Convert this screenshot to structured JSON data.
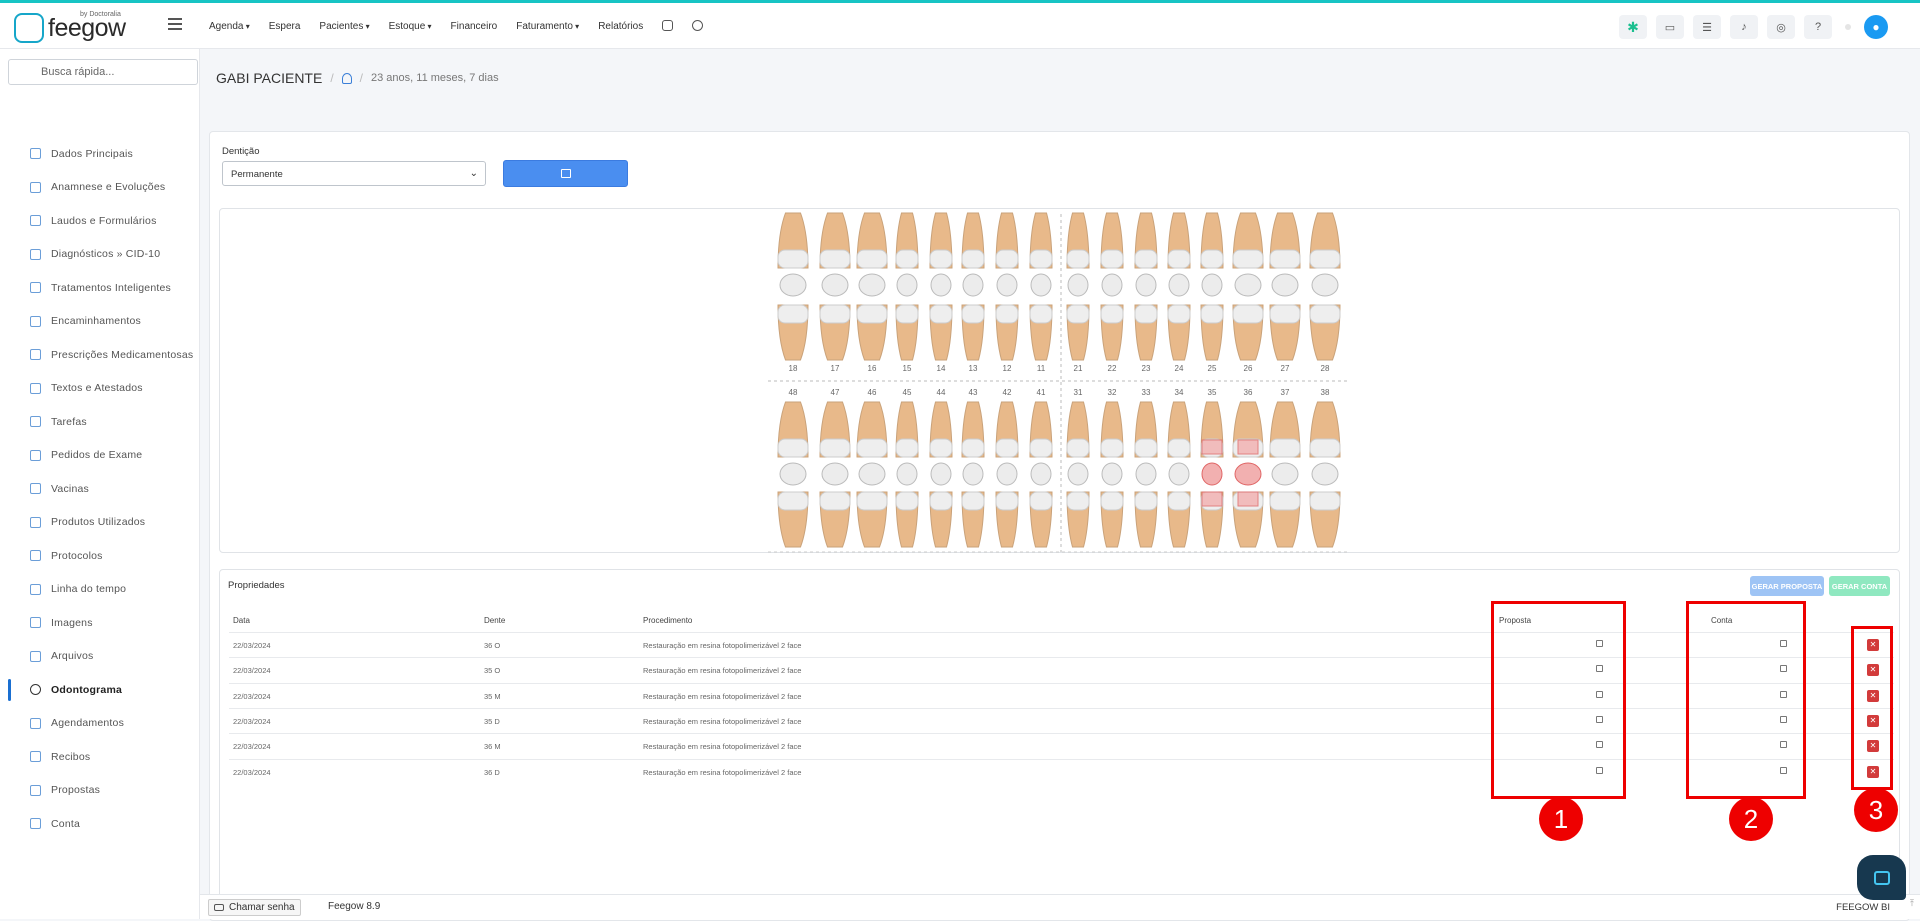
{
  "brand": {
    "name": "feegow",
    "sub": "by Doctoralia"
  },
  "nav": {
    "agenda": "Agenda",
    "espera": "Espera",
    "pacientes": "Pacientes",
    "estoque": "Estoque",
    "financeiro": "Financeiro",
    "faturamento": "Faturamento",
    "relatorios": "Relatórios"
  },
  "accent_color": "#17c4c4",
  "search": {
    "placeholder": "Busca rápida..."
  },
  "sidebar": {
    "items": [
      {
        "label": "Dados Principais",
        "icon": "user-icon"
      },
      {
        "label": "Anamnese e Evoluções",
        "icon": "chart-line-icon"
      },
      {
        "label": "Laudos e Formulários",
        "icon": "clipboard-icon"
      },
      {
        "label": "Diagnósticos » CID-10",
        "icon": "stethoscope-icon"
      },
      {
        "label": "Tratamentos Inteligentes",
        "icon": "stethoscope-icon"
      },
      {
        "label": "Encaminhamentos",
        "icon": "file-icon"
      },
      {
        "label": "Prescrições Medicamentosas",
        "icon": "pills-icon"
      },
      {
        "label": "Textos e Atestados",
        "icon": "file-text-icon"
      },
      {
        "label": "Tarefas",
        "icon": "list-icon"
      },
      {
        "label": "Pedidos de Exame",
        "icon": "clipboard-icon"
      },
      {
        "label": "Vacinas",
        "icon": "syringe-icon"
      },
      {
        "label": "Produtos Utilizados",
        "icon": "box-icon"
      },
      {
        "label": "Protocolos",
        "icon": "clipboard-icon"
      },
      {
        "label": "Linha do tempo",
        "icon": "timeline-icon"
      },
      {
        "label": "Imagens",
        "icon": "camera-icon"
      },
      {
        "label": "Arquivos",
        "icon": "folder-icon"
      },
      {
        "label": "Odontograma",
        "icon": "globe-icon"
      },
      {
        "label": "Agendamentos",
        "icon": "calendar-icon"
      },
      {
        "label": "Recibos",
        "icon": "receipt-icon"
      },
      {
        "label": "Propostas",
        "icon": "copy-icon"
      },
      {
        "label": "Conta",
        "icon": "money-icon"
      }
    ],
    "active": "Odontograma"
  },
  "patient": {
    "name": "GABI PACIENTE",
    "age": "23 anos, 11 meses, 7 dias"
  },
  "denticao": {
    "label": "Dentição",
    "value": "Permanente"
  },
  "teeth_numbers": {
    "upper": [
      "18",
      "17",
      "16",
      "15",
      "14",
      "13",
      "12",
      "11",
      "21",
      "22",
      "23",
      "24",
      "25",
      "26",
      "27",
      "28"
    ],
    "lower": [
      "48",
      "47",
      "46",
      "45",
      "44",
      "43",
      "42",
      "41",
      "31",
      "32",
      "33",
      "34",
      "35",
      "36",
      "37",
      "38"
    ]
  },
  "marked_teeth": [
    "35",
    "36"
  ],
  "properties": {
    "title": "Propriedades",
    "gerar_proposta": "GERAR PROPOSTA",
    "gerar_conta": "GERAR CONTA",
    "headers": {
      "data": "Data",
      "dente": "Dente",
      "procedimento": "Procedimento",
      "proposta": "Proposta",
      "conta": "Conta"
    },
    "rows": [
      {
        "data": "22/03/2024",
        "dente": "36 O",
        "procedimento": "Restauração em resina fotopolimerizável 2 face"
      },
      {
        "data": "22/03/2024",
        "dente": "35 O",
        "procedimento": "Restauração em resina fotopolimerizável 2 face"
      },
      {
        "data": "22/03/2024",
        "dente": "35 M",
        "procedimento": "Restauração em resina fotopolimerizável 2 face"
      },
      {
        "data": "22/03/2024",
        "dente": "35 D",
        "procedimento": "Restauração em resina fotopolimerizável 2 face"
      },
      {
        "data": "22/03/2024",
        "dente": "36 M",
        "procedimento": "Restauração em resina fotopolimerizável 2 face"
      },
      {
        "data": "22/03/2024",
        "dente": "36 D",
        "procedimento": "Restauração em resina fotopolimerizável 2 face"
      }
    ]
  },
  "annotations": [
    "1",
    "2",
    "3"
  ],
  "footer": {
    "chamar": "Chamar senha",
    "version": "Feegow 8.9",
    "right": "FEEGOW BI"
  }
}
